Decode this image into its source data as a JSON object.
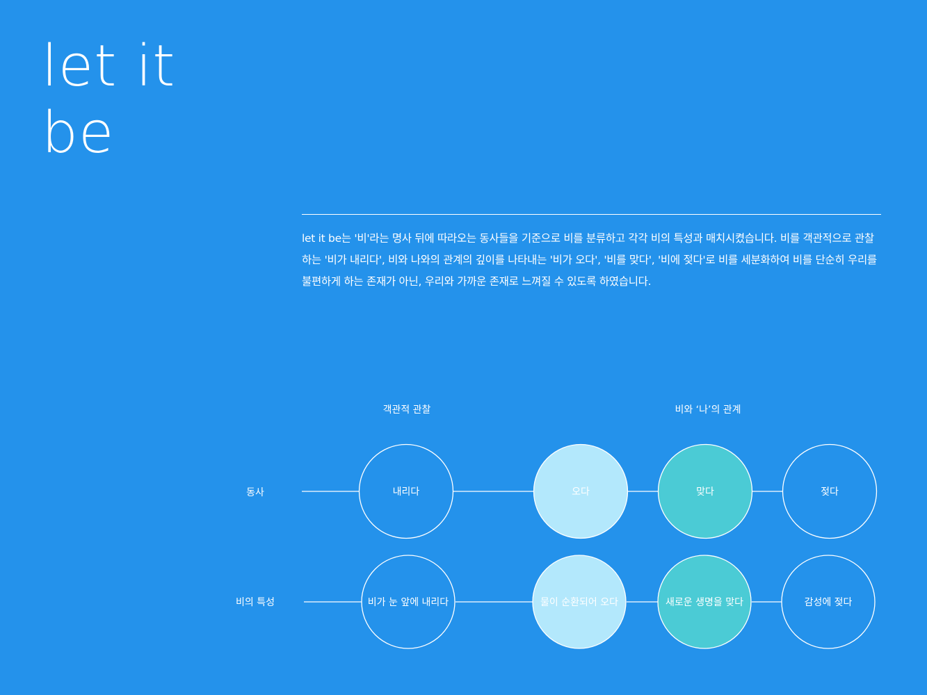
{
  "title": {
    "line1": "let it",
    "line2": "be"
  },
  "intro": "let it be는 '비'라는 명사 뒤에 따라오는 동사들을 기준으로 비를 분류하고 각각 비의 특성과 매치시켰습니다. 비를 객관적으로 관찰하는 '비가 내리다', 비와 나와의 관계의 깊이를 나타내는 '비가 오다', '비를 맞다', '비에 젖다'로 비를 세분화하여 비를 단순히 우리를 불편하게 하는 존재가 아닌, 우리와 가까운 존재로 느껴질 수 있도록 하였습니다.",
  "diagram": {
    "column_headers": [
      "객관적 관찰",
      "비와 ‘나’의 관계"
    ],
    "row_headers": [
      "동사",
      "비의 특성"
    ],
    "verbs": [
      {
        "label": "내리다",
        "fill": "none"
      },
      {
        "label": "오다",
        "fill": "#B3E8FC"
      },
      {
        "label": "맞다",
        "fill": "#4BCBD5"
      },
      {
        "label": "젖다",
        "fill": "none"
      }
    ],
    "traits": [
      {
        "label": "비가 눈 앞에 내리다",
        "fill": "none"
      },
      {
        "label": "물이 순환되어 오다",
        "fill": "#B3E8FC"
      },
      {
        "label": "새로운 생명을 맞다",
        "fill": "#4BCBD5"
      },
      {
        "label": "감성에 젖다",
        "fill": "none"
      }
    ],
    "colors": {
      "background": "#2492EB",
      "line": "#FFFFFF",
      "light_fill": "#B3E8FC",
      "teal_fill": "#4BCBD5"
    }
  }
}
